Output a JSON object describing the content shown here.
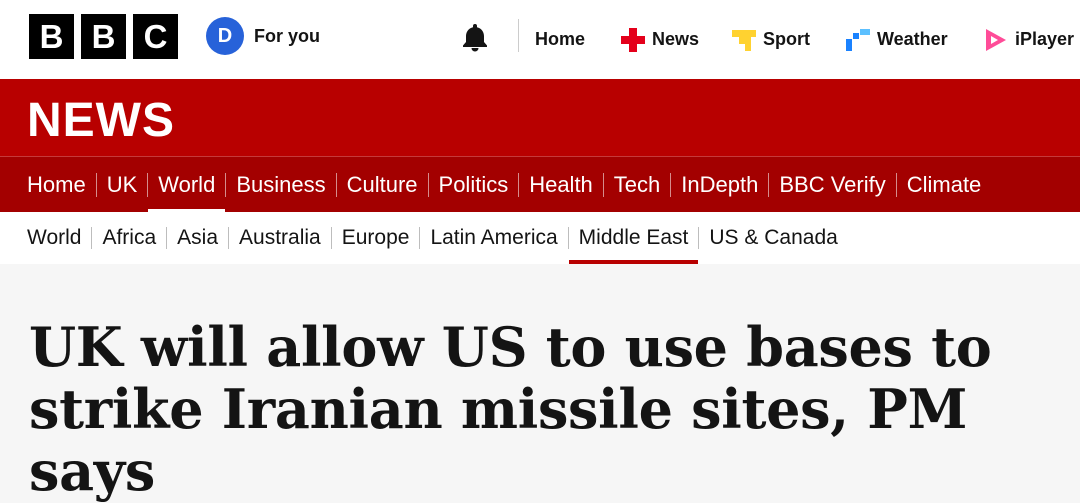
{
  "topbar": {
    "logo_letters": [
      "B",
      "B",
      "C"
    ],
    "account_initial": "D",
    "for_you_label": "For you",
    "nav": [
      {
        "label": "Home",
        "icon": "home"
      },
      {
        "label": "News",
        "icon": "news-icon",
        "color": "#e4001b"
      },
      {
        "label": "Sport",
        "icon": "sport-icon",
        "color": "#ffd230"
      },
      {
        "label": "Weather",
        "icon": "weather-icon",
        "color": "#1a82ff"
      },
      {
        "label": "iPlayer",
        "icon": "iplayer-icon",
        "color": "#ff4c98"
      }
    ]
  },
  "banner": {
    "brand": "NEWS",
    "color": "#b80000"
  },
  "primary_nav": [
    {
      "label": "Home"
    },
    {
      "label": "UK"
    },
    {
      "label": "World",
      "active": true
    },
    {
      "label": "Business"
    },
    {
      "label": "Culture"
    },
    {
      "label": "Politics"
    },
    {
      "label": "Health"
    },
    {
      "label": "Tech"
    },
    {
      "label": "InDepth"
    },
    {
      "label": "BBC Verify"
    },
    {
      "label": "Climate"
    }
  ],
  "secondary_nav": [
    {
      "label": "World"
    },
    {
      "label": "Africa"
    },
    {
      "label": "Asia"
    },
    {
      "label": "Australia"
    },
    {
      "label": "Europe"
    },
    {
      "label": "Latin America"
    },
    {
      "label": "Middle East",
      "active": true
    },
    {
      "label": "US & Canada"
    }
  ],
  "article": {
    "headline": "UK will allow US to use bases to strike Iranian missile sites, PM says"
  }
}
